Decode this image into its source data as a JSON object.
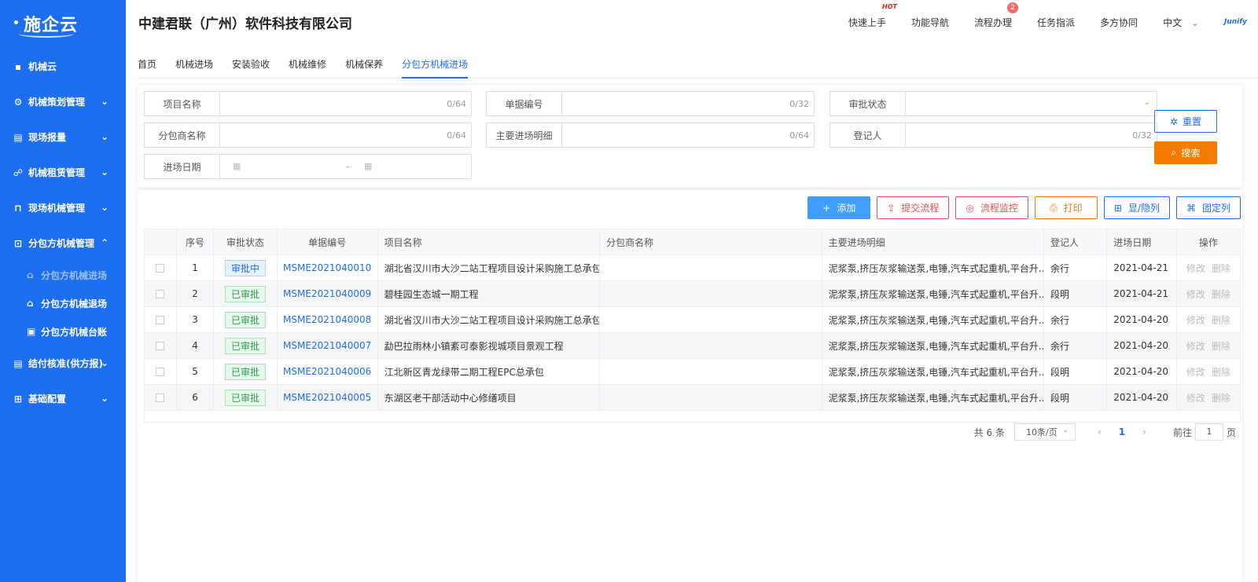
{
  "sidebar": {
    "logo": "施企云",
    "items": [
      {
        "label": "机械云"
      },
      {
        "label": "机械策划管理"
      },
      {
        "label": "现场报量"
      },
      {
        "label": "机械租赁管理"
      },
      {
        "label": "现场机械管理"
      },
      {
        "label": "分包方机械管理"
      },
      {
        "label": "结付核准(供方报)"
      },
      {
        "label": "基础配置"
      }
    ],
    "subitems": [
      {
        "label": "分包方机械进场"
      },
      {
        "label": "分包方机械退场"
      },
      {
        "label": "分包方机械台账"
      }
    ]
  },
  "header": {
    "company": "中建君联（广州）软件科技有限公司",
    "nav": [
      "快速上手",
      "功能导航",
      "流程办理",
      "任务指派",
      "多方协同"
    ],
    "hot_label": "HOT",
    "badge_count": "2",
    "lang": "中文",
    "brand": "Junify"
  },
  "tabs": [
    "首页",
    "机械进场",
    "安装验收",
    "机械维修",
    "机械保养",
    "分包方机械进场"
  ],
  "filters": {
    "project_name": {
      "label": "项目名称",
      "count": "0/64"
    },
    "doc_no": {
      "label": "单据编号",
      "count": "0/32"
    },
    "approval_status": {
      "label": "审批状态"
    },
    "subcontractor": {
      "label": "分包商名称",
      "count": "0/64"
    },
    "detail": {
      "label": "主要进场明细",
      "count": "0/64"
    },
    "registrant": {
      "label": "登记人",
      "count": "0/32"
    },
    "entry_date": {
      "label": "进场日期",
      "separator": "-"
    }
  },
  "buttons": {
    "reset": "重置",
    "search": "搜索",
    "add": "添加",
    "submit_flow": "提交流程",
    "monitor_flow": "流程监控",
    "print": "打印",
    "show_hide": "显/隐列",
    "fix_col": "固定列"
  },
  "table": {
    "columns": [
      "序号",
      "审批状态",
      "单据编号",
      "项目名称",
      "分包商名称",
      "主要进场明细",
      "登记人",
      "进场日期",
      "操作"
    ],
    "rows": [
      {
        "no": "1",
        "status": "审批中",
        "status_type": "pending",
        "doc": "MSME2021040010",
        "project": "湖北省汉川市大沙二站工程项目设计采购施工总承包",
        "sub": "",
        "detail": "泥浆泵,挤压灰浆输送泵,电锤,汽车式起重机,平台升...",
        "registrant": "余行",
        "date": "2021-04-21"
      },
      {
        "no": "2",
        "status": "已审批",
        "status_type": "done",
        "doc": "MSME2021040009",
        "project": "碧桂园生态城一期工程",
        "sub": "",
        "detail": "泥浆泵,挤压灰浆输送泵,电锤,汽车式起重机,平台升...",
        "registrant": "段明",
        "date": "2021-04-21"
      },
      {
        "no": "3",
        "status": "已审批",
        "status_type": "done",
        "doc": "MSME2021040008",
        "project": "湖北省汉川市大沙二站工程项目设计采购施工总承包",
        "sub": "",
        "detail": "泥浆泵,挤压灰浆输送泵,电锤,汽车式起重机,平台升...",
        "registrant": "余行",
        "date": "2021-04-20"
      },
      {
        "no": "4",
        "status": "已审批",
        "status_type": "done",
        "doc": "MSME2021040007",
        "project": "勐巴拉雨林小镇紊可泰影视城项目景观工程",
        "sub": "",
        "detail": "泥浆泵,挤压灰浆输送泵,电锤,汽车式起重机,平台升...",
        "registrant": "余行",
        "date": "2021-04-20"
      },
      {
        "no": "5",
        "status": "已审批",
        "status_type": "done",
        "doc": "MSME2021040006",
        "project": "江北新区青龙绿带二期工程EPC总承包",
        "sub": "",
        "detail": "泥浆泵,挤压灰浆输送泵,电锤,汽车式起重机,平台升...",
        "registrant": "段明",
        "date": "2021-04-20"
      },
      {
        "no": "6",
        "status": "已审批",
        "status_type": "done",
        "doc": "MSME2021040005",
        "project": "东湖区老干部活动中心修缮项目",
        "sub": "",
        "detail": "泥浆泵,挤压灰浆输送泵,电锤,汽车式起重机,平台升...",
        "registrant": "段明",
        "date": "2021-04-20"
      }
    ],
    "op_edit": "修改",
    "op_delete": "删除"
  },
  "pager": {
    "total": "共 6 条",
    "size": "10条/页",
    "current": "1",
    "goto": "前往",
    "goto_value": "1",
    "page_unit": "页"
  },
  "colors": {
    "primary": "#1e6ff0",
    "search": "#f57c00",
    "danger": "#e05252"
  }
}
